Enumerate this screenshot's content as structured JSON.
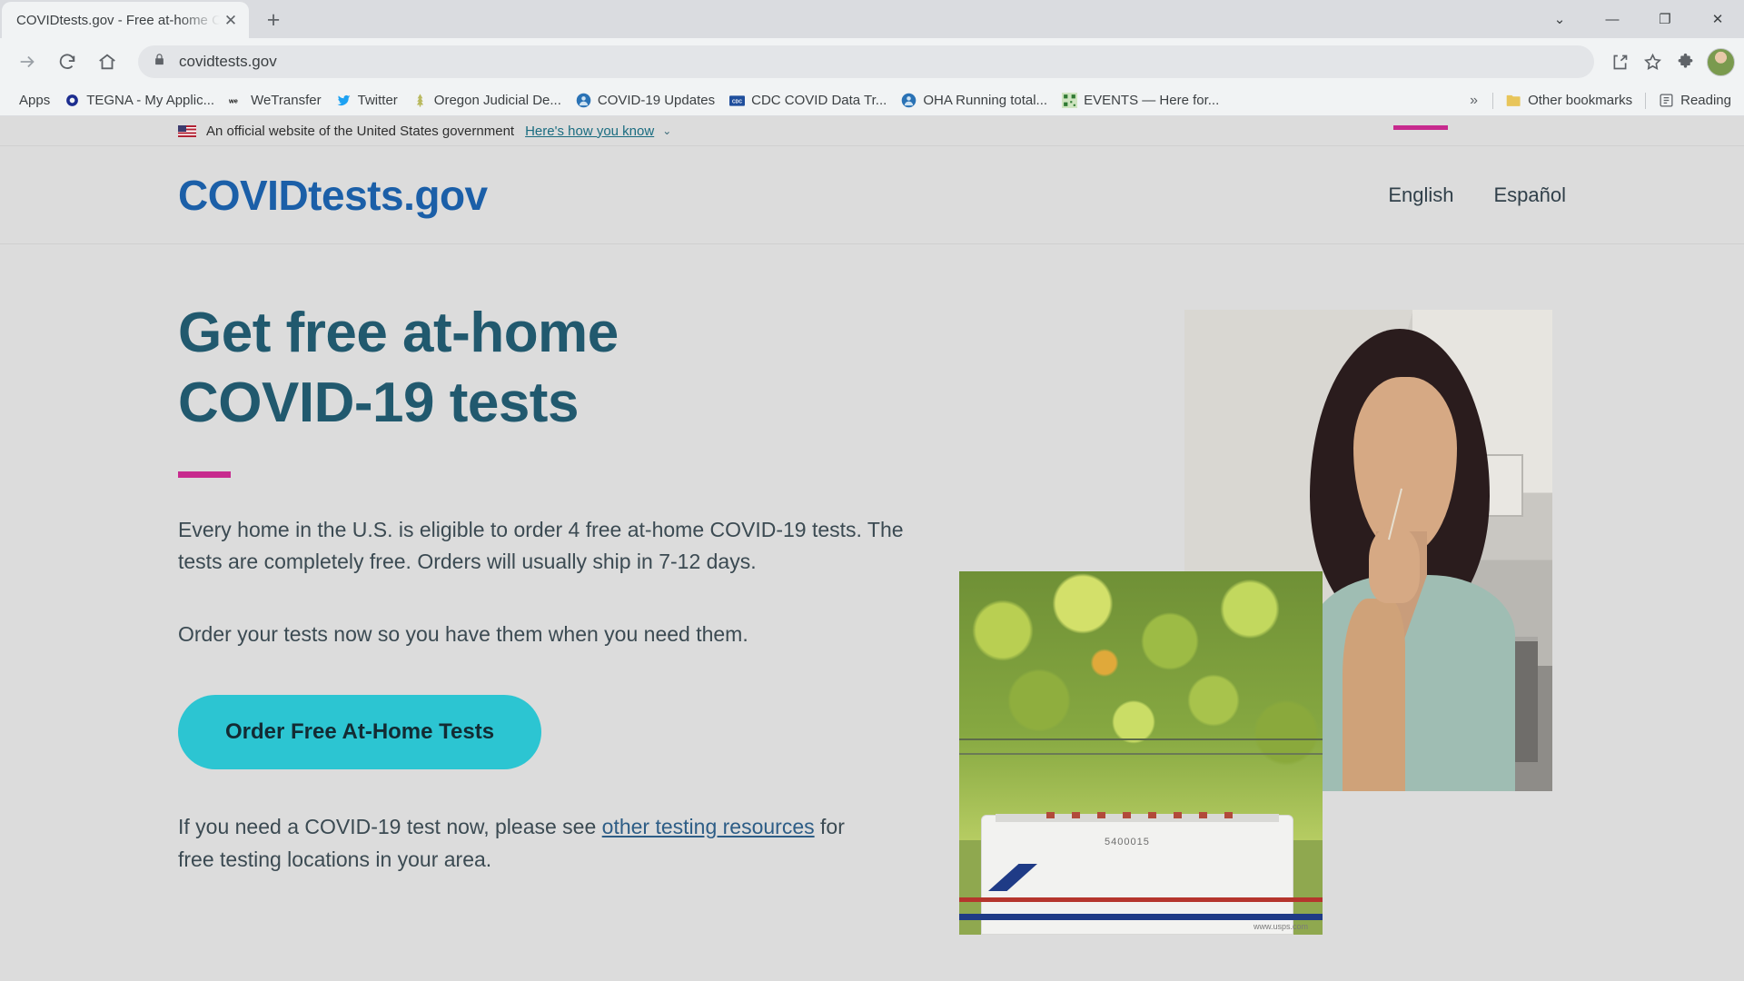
{
  "browser": {
    "tab": {
      "title": "COVIDtests.gov - Free at-home C",
      "close_icon": "✕"
    },
    "new_tab_icon": "+",
    "window_controls": [
      {
        "name": "minimize-to-tray-chevron",
        "glyph": "⌄"
      },
      {
        "name": "minimize",
        "glyph": "—"
      },
      {
        "name": "maximize",
        "glyph": "❐"
      },
      {
        "name": "close",
        "glyph": "✕"
      }
    ],
    "toolbar": {
      "forward_icon": "→",
      "reload_icon": "⟳",
      "home_icon": "⌂",
      "lock_icon": "🔒",
      "url": "covidtests.gov",
      "share_icon": "share-icon",
      "bookmark_star_icon": "☆",
      "extensions_icon": "puzzle-icon",
      "profile_avatar": "avatar"
    },
    "bookmarks": {
      "apps_label": "Apps",
      "items": [
        {
          "label": "TEGNA - My Applic...",
          "icon": "tegna-o-icon"
        },
        {
          "label": "WeTransfer",
          "icon": "wetransfer-icon"
        },
        {
          "label": "Twitter",
          "icon": "twitter-bird-icon"
        },
        {
          "label": "Oregon Judicial De...",
          "icon": "oregon-tree-icon"
        },
        {
          "label": "COVID-19 Updates",
          "icon": "covid-person-icon"
        },
        {
          "label": "CDC COVID Data Tr...",
          "icon": "cdc-icon"
        },
        {
          "label": "OHA Running total...",
          "icon": "oha-person-icon"
        },
        {
          "label": "EVENTS — Here for...",
          "icon": "events-qr-icon"
        }
      ],
      "overflow_icon": "»",
      "other_bookmarks_label": "Other bookmarks",
      "reading_list_label": "Reading"
    }
  },
  "page": {
    "gov_banner": {
      "flag_icon": "us-flag-icon",
      "text": "An official website of the United States government",
      "link": "Here's how you know",
      "chevron": "⌄"
    },
    "header": {
      "logo": "COVIDtests.gov",
      "languages": [
        {
          "label": "English",
          "active": true
        },
        {
          "label": "Español",
          "active": false
        }
      ]
    },
    "hero": {
      "title_line1": "Get free at-home",
      "title_line2": "COVID-19 tests",
      "paragraph1": "Every home in the U.S. is eligible to order 4 free at-home COVID-19 tests. The tests are completely free. Orders will usually ship in 7-12 days.",
      "paragraph2": "Order your tests now so you have them when you need them.",
      "cta_label": "Order Free At-Home Tests",
      "note_before": "If you need a COVID-19 test now, please see ",
      "note_link": "other testing resources",
      "note_after": " for free testing locations in your area.",
      "images": [
        {
          "name": "woman-swabbing-nose-photo",
          "alt": "Woman using an at-home COVID-19 nasal swab test in a kitchen"
        },
        {
          "name": "usps-mail-truck-photo",
          "alt": "USPS mail delivery truck under green trees",
          "truck_number": "5400015",
          "truck_url": "www.usps.com"
        }
      ]
    }
  },
  "colors": {
    "heading_teal": "#21596e",
    "logo_blue": "#1b5fa8",
    "accent_pink": "#c72a8e",
    "cta_turquoise": "#2cc5d2",
    "link_blue": "#2d5d86",
    "page_bg": "#dcdcdc"
  }
}
